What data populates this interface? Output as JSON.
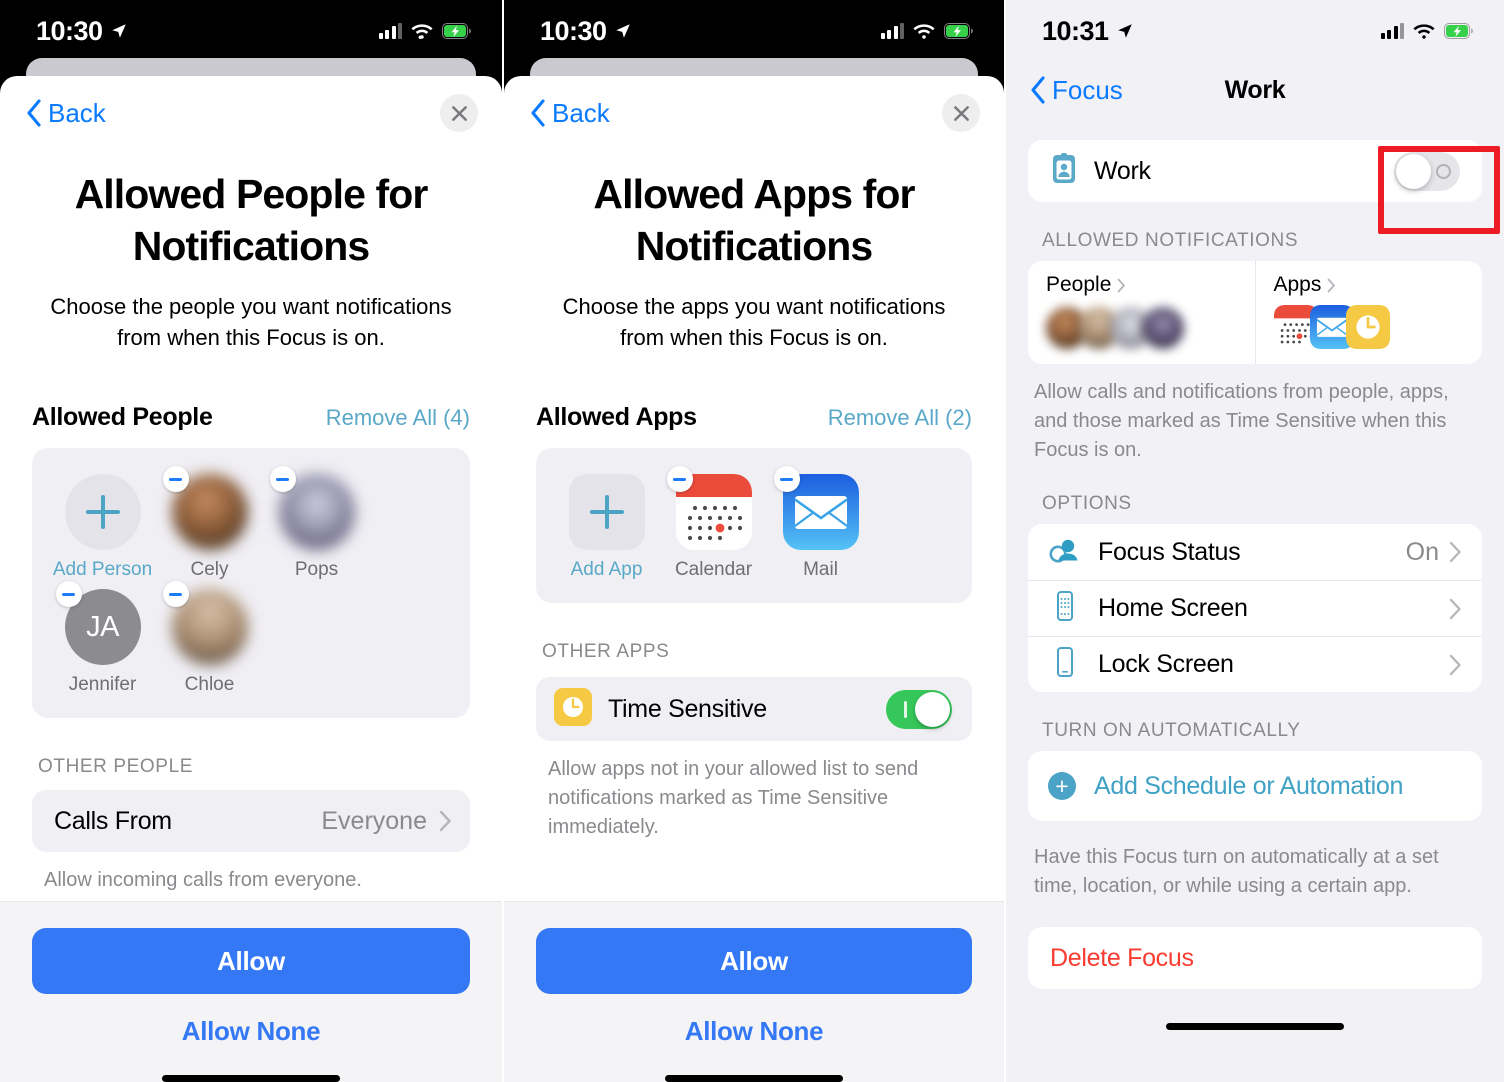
{
  "panel1": {
    "status": {
      "time": "10:30",
      "location_icon": "location-arrow-icon",
      "signal_icon": "cellular-bars-icon",
      "wifi_icon": "wifi-icon",
      "battery_icon": "battery-charging-icon"
    },
    "nav": {
      "back_label": "Back",
      "close_icon": "close-icon"
    },
    "title": "Allowed People for Notifications",
    "subtitle": "Choose the people you want notifications from when this Focus is on.",
    "section": {
      "label": "Allowed People",
      "action": "Remove All (4)"
    },
    "add_tile": {
      "label": "Add Person",
      "icon": "plus-icon"
    },
    "people": [
      {
        "name": "Cely",
        "type": "photo",
        "color1": "#b07a52",
        "color2": "#4a3524"
      },
      {
        "name": "Pops",
        "type": "photo",
        "color1": "#9aa0b4",
        "color2": "#55506b"
      },
      {
        "name": "Jennifer",
        "type": "initials",
        "initials": "JA"
      },
      {
        "name": "Chloe",
        "type": "photo",
        "color1": "#b69c85",
        "color2": "#4a3e33"
      }
    ],
    "other_group_label": "OTHER PEOPLE",
    "calls_row": {
      "label": "Calls From",
      "value": "Everyone",
      "chevron_icon": "chevron-right-icon"
    },
    "calls_note": "Allow incoming calls from everyone.",
    "primary_button": "Allow",
    "link_button": "Allow None"
  },
  "panel2": {
    "status": {
      "time": "10:30",
      "location_icon": "location-arrow-icon",
      "signal_icon": "cellular-bars-icon",
      "wifi_icon": "wifi-icon",
      "battery_icon": "battery-charging-icon"
    },
    "nav": {
      "back_label": "Back",
      "close_icon": "close-icon"
    },
    "title": "Allowed Apps for Notifications",
    "subtitle": "Choose the apps you want notifications from when this Focus is on.",
    "section": {
      "label": "Allowed Apps",
      "action": "Remove All (2)"
    },
    "add_tile": {
      "label": "Add App",
      "icon": "plus-icon"
    },
    "apps": [
      {
        "name": "Calendar",
        "icon": "calendar-app-icon"
      },
      {
        "name": "Mail",
        "icon": "mail-app-icon"
      }
    ],
    "other_group_label": "OTHER APPS",
    "time_sensitive": {
      "label": "Time Sensitive",
      "icon": "clock-app-icon",
      "enabled": "on"
    },
    "time_sensitive_note": "Allow apps not in your allowed list to send notifications marked as Time Sensitive immediately.",
    "primary_button": "Allow",
    "link_button": "Allow None"
  },
  "panel3": {
    "status": {
      "time": "10:31",
      "location_icon": "location-arrow-icon",
      "signal_icon": "cellular-bars-icon",
      "wifi_icon": "wifi-icon",
      "battery_icon": "battery-charging-icon"
    },
    "nav": {
      "back_label": "Focus",
      "title": "Work"
    },
    "work_row": {
      "label": "Work",
      "icon": "id-badge-icon",
      "toggle_state": "off"
    },
    "allowed_header": "ALLOWED NOTIFICATIONS",
    "people_card": {
      "label": "People",
      "chevron_icon": "chevron-right-icon"
    },
    "apps_card": {
      "label": "Apps",
      "chevron_icon": "chevron-right-icon",
      "icons": [
        "calendar-app-icon",
        "mail-app-icon",
        "clock-app-icon"
      ]
    },
    "allowed_note": "Allow calls and notifications from people, apps, and those marked as Time Sensitive when this Focus is on.",
    "options_header": "OPTIONS",
    "options": [
      {
        "label": "Focus Status",
        "value": "On",
        "icon": "focus-status-icon"
      },
      {
        "label": "Home Screen",
        "value": "",
        "icon": "home-screen-icon"
      },
      {
        "label": "Lock Screen",
        "value": "",
        "icon": "lock-screen-icon"
      }
    ],
    "auto_header": "TURN ON AUTOMATICALLY",
    "add_schedule": {
      "label": "Add Schedule or Automation",
      "icon": "plus-circle-icon"
    },
    "auto_note": "Have this Focus turn on automatically at a set time, location, or while using a certain app.",
    "delete": {
      "label": "Delete Focus"
    }
  },
  "colors": {
    "ios_blue": "#3478f6",
    "link_blue": "#0a7aff",
    "teal": "#4ba3c7",
    "green_on": "#35c759",
    "destructive_red": "#fb3b30",
    "highlight_red": "#ec1c24"
  }
}
